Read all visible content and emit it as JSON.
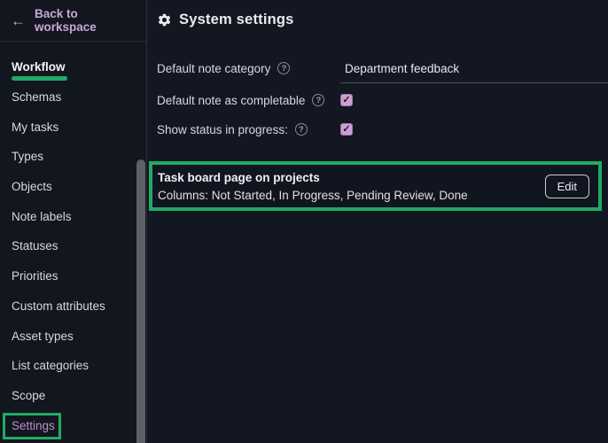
{
  "colors": {
    "background": "#131722",
    "sidebar_background": "#12161f",
    "annotation_green": "#21ab63",
    "link_purple": "#c9a6d8",
    "checkbox_purple": "#cb9fd2"
  },
  "icons": {
    "back_arrow": "←",
    "help": "?",
    "check": "✓",
    "gear": "gear"
  },
  "sidebar": {
    "back_label": "Back to workspace",
    "items": [
      {
        "label": "Workflow",
        "state": "active"
      },
      {
        "label": "Schemas",
        "state": "default"
      },
      {
        "label": "My tasks",
        "state": "default"
      },
      {
        "label": "Types",
        "state": "default"
      },
      {
        "label": "Objects",
        "state": "default"
      },
      {
        "label": "Note labels",
        "state": "default"
      },
      {
        "label": "Statuses",
        "state": "default"
      },
      {
        "label": "Priorities",
        "state": "default"
      },
      {
        "label": "Custom attributes",
        "state": "default"
      },
      {
        "label": "Asset types",
        "state": "default"
      },
      {
        "label": "List categories",
        "state": "default"
      },
      {
        "label": "Scope",
        "state": "default"
      },
      {
        "label": "Settings",
        "state": "highlighted"
      }
    ]
  },
  "header": {
    "title": "System settings"
  },
  "form": {
    "rows": [
      {
        "label": "Default note category",
        "control": "text-input",
        "value": "Department feedback"
      },
      {
        "label": "Default note as completable",
        "control": "checkbox",
        "checked": true
      },
      {
        "label": "Show status in progress:",
        "control": "checkbox",
        "checked": true
      }
    ]
  },
  "task_board": {
    "title": "Task board page on projects",
    "subtitle": "Columns: Not Started, In Progress, Pending Review, Done",
    "edit_label": "Edit"
  }
}
